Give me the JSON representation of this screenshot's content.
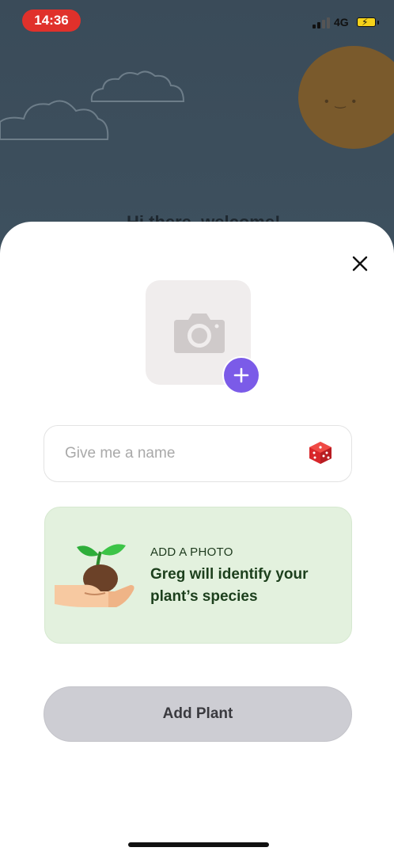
{
  "status_bar": {
    "time": "14:36",
    "network": "4G"
  },
  "background": {
    "partial_text": "Hi there, welcome!"
  },
  "sheet": {
    "close_icon": "close-icon",
    "photo_placeholder_icon": "camera-icon",
    "add_photo_icon": "plus-icon",
    "name_field": {
      "placeholder": "Give me a name",
      "value": ""
    },
    "random_name_icon": "dice-icon",
    "info_card": {
      "kicker": "ADD A PHOTO",
      "text": "Greg will identify your plant’s species"
    },
    "add_button_label": "Add Plant"
  },
  "colors": {
    "accent_purple": "#7b5be8",
    "card_green": "#e3f1de",
    "button_gray": "#cdcdd3",
    "time_pill_red": "#e0312b"
  }
}
